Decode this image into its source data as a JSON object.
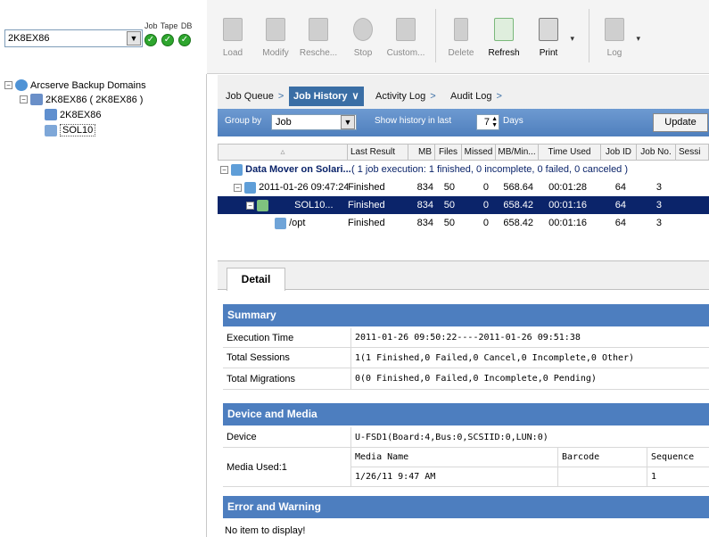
{
  "server": {
    "name": "2K8EX86",
    "status_labels": [
      "Job",
      "Tape",
      "DB"
    ]
  },
  "tree": [
    {
      "label": "Arcserve Backup Domains"
    },
    {
      "label": "2K8EX86 ( 2K8EX86 )"
    },
    {
      "label": "2K8EX86"
    },
    {
      "label": "SOL10"
    }
  ],
  "toolbar": [
    {
      "label": "Load",
      "enabled": false
    },
    {
      "label": "Modify",
      "enabled": false
    },
    {
      "label": "Resche...",
      "enabled": false
    },
    {
      "label": "Stop",
      "enabled": false
    },
    {
      "label": "Custom...",
      "enabled": false
    },
    {
      "label": "Delete",
      "enabled": false
    },
    {
      "label": "Refresh",
      "enabled": true
    },
    {
      "label": "Print",
      "enabled": true
    },
    {
      "label": "Log",
      "enabled": false
    }
  ],
  "tabs": [
    {
      "label": "Job Queue",
      "active": false
    },
    {
      "label": "Job History",
      "active": true
    },
    {
      "label": "Activity Log",
      "active": false
    },
    {
      "label": "Audit Log",
      "active": false
    }
  ],
  "group_bar": {
    "group_by_label": "Group by",
    "group_by_value": "Job",
    "history_label": "Show history in last",
    "days_value": "7",
    "days_label": "Days",
    "update_button": "Update"
  },
  "grid": {
    "columns": [
      "",
      "Last Result",
      "MB",
      "Files",
      "Missed",
      "MB/Min...",
      "Time Used",
      "Job ID",
      "Job No.",
      "Sessi"
    ],
    "group_row": {
      "name": "Data Mover on Solari...",
      "summary": "( 1 job execution: 1 finished, 0 incomplete, 0 failed, 0 canceled )"
    },
    "rows": [
      {
        "name": "2011-01-26 09:47:24",
        "result": "Finished",
        "mb": "834",
        "files": "50",
        "missed": "0",
        "mbmin": "568.64",
        "time": "00:01:28",
        "jobid": "64",
        "jobno": "3",
        "selected": false
      },
      {
        "name": "SOL10...",
        "result": "Finished",
        "mb": "834",
        "files": "50",
        "missed": "0",
        "mbmin": "658.42",
        "time": "00:01:16",
        "jobid": "64",
        "jobno": "3",
        "selected": true
      },
      {
        "name": "/opt",
        "result": "Finished",
        "mb": "834",
        "files": "50",
        "missed": "0",
        "mbmin": "658.42",
        "time": "00:01:16",
        "jobid": "64",
        "jobno": "3",
        "selected": false
      }
    ]
  },
  "detail": {
    "tab": "Detail",
    "summary_title": "Summary",
    "execution_time_label": "Execution Time",
    "execution_time": "2011-01-26 09:50:22----2011-01-26 09:51:38",
    "total_sessions_label": "Total Sessions",
    "total_sessions": "1(1 Finished,0 Failed,0 Cancel,0 Incomplete,0 Other)",
    "total_migrations_label": "Total Migrations",
    "total_migrations": "0(0 Finished,0 Failed,0 Incomplete,0 Pending)",
    "device_media_title": "Device and Media",
    "device_label": "Device",
    "device": "U-FSD1(Board:4,Bus:0,SCSIID:0,LUN:0)",
    "media_used_label": "Media Used:1",
    "media_headers": [
      "Media Name",
      "Barcode",
      "Sequence"
    ],
    "media_row": [
      "1/26/11 9:47 AM",
      "",
      "1"
    ],
    "error_title": "Error and Warning",
    "no_item": "No item to display!"
  },
  "colors": {
    "accent": "#3a6ea5",
    "section": "#4d7ebf",
    "selection": "#0b246a",
    "ok": "#2ea62e"
  }
}
